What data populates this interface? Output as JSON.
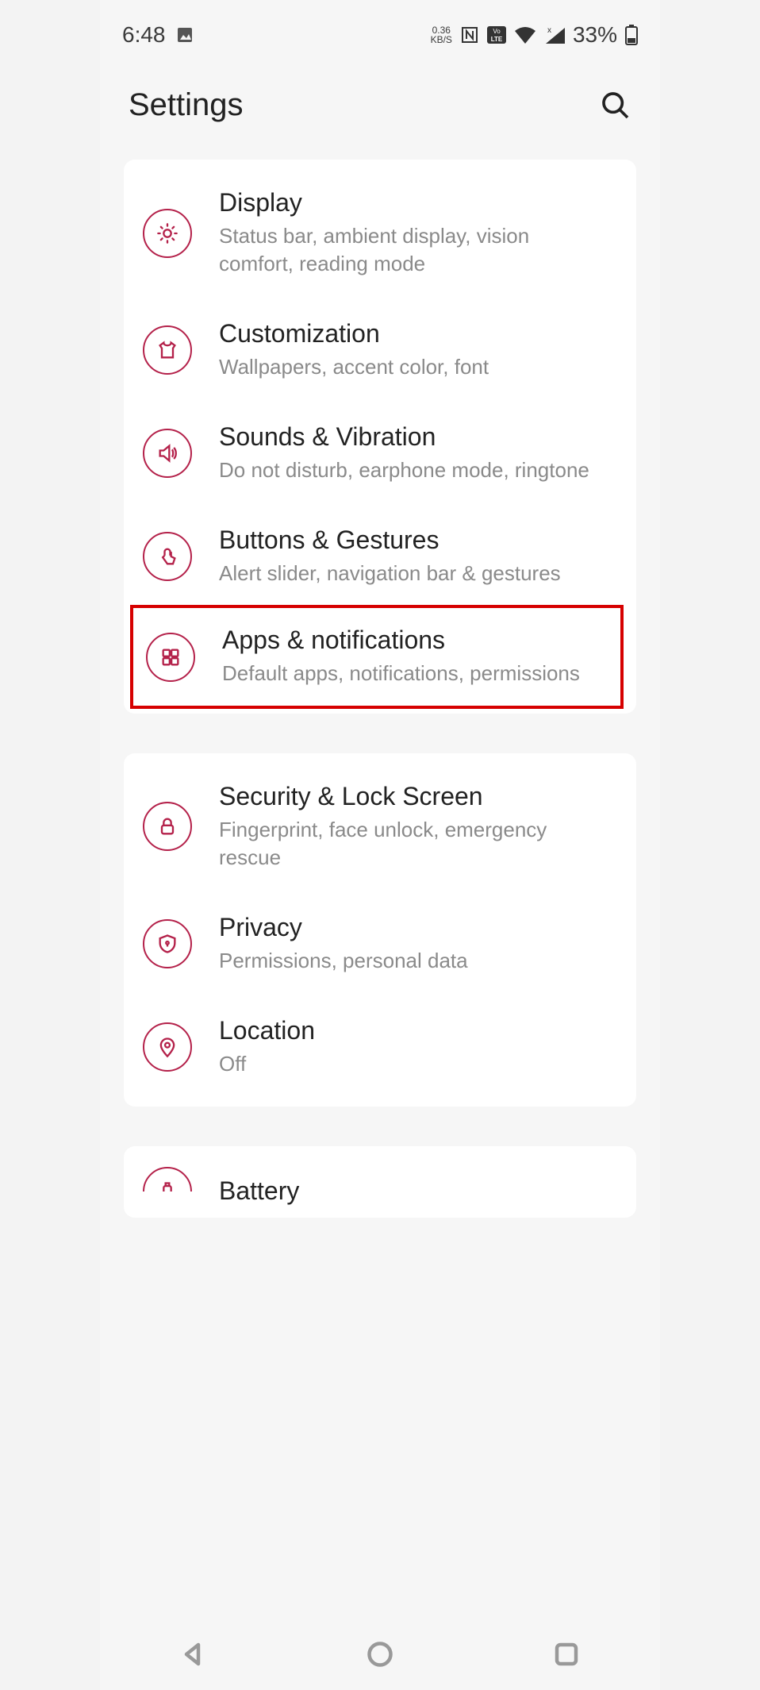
{
  "status": {
    "time": "6:48",
    "data_rate_top": "0.36",
    "data_rate_bottom": "KB/S",
    "battery_pct": "33%"
  },
  "header": {
    "title": "Settings"
  },
  "groups": [
    {
      "items": [
        {
          "id": "display",
          "title": "Display",
          "sub": "Status bar, ambient display, vision comfort, reading mode"
        },
        {
          "id": "customization",
          "title": "Customization",
          "sub": "Wallpapers, accent color, font"
        },
        {
          "id": "sounds",
          "title": "Sounds & Vibration",
          "sub": "Do not disturb, earphone mode, ringtone"
        },
        {
          "id": "buttons",
          "title": "Buttons & Gestures",
          "sub": "Alert slider, navigation bar & gestures"
        },
        {
          "id": "apps",
          "title": "Apps & notifications",
          "sub": "Default apps, notifications, permissions",
          "highlighted": true
        }
      ]
    },
    {
      "items": [
        {
          "id": "security",
          "title": "Security & Lock Screen",
          "sub": "Fingerprint, face unlock, emergency rescue"
        },
        {
          "id": "privacy",
          "title": "Privacy",
          "sub": "Permissions, personal data"
        },
        {
          "id": "location",
          "title": "Location",
          "sub": "Off"
        }
      ]
    },
    {
      "items": [
        {
          "id": "battery",
          "title": "Battery",
          "sub": ""
        }
      ]
    }
  ]
}
